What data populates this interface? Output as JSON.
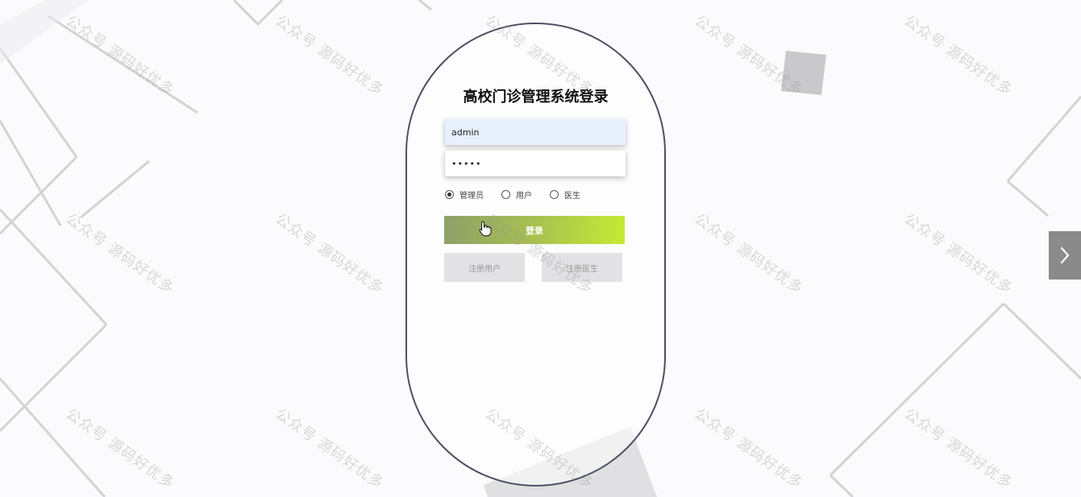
{
  "login": {
    "title": "高校门诊管理系统登录",
    "username_value": "admin",
    "password_value": "•••••",
    "roles": [
      {
        "label": "管理员",
        "checked": true
      },
      {
        "label": "用户",
        "checked": false
      },
      {
        "label": "医生",
        "checked": false
      }
    ],
    "login_label": "登录",
    "register_user_label": "注册用户",
    "register_doctor_label": "注册医生"
  },
  "watermark": {
    "text": "公众号 源码好优多"
  },
  "icons": {
    "next": "chevron-right-icon",
    "cursor": "hand-pointer-icon"
  },
  "colors": {
    "card_border": "#4d5063",
    "gradient_start": "#8fa06a",
    "gradient_end": "#c6ea33",
    "register_bg": "#e2e2e4",
    "input_autofill_bg": "#e8f0fe",
    "nav_arrow_bg": "#8a8a8a"
  }
}
